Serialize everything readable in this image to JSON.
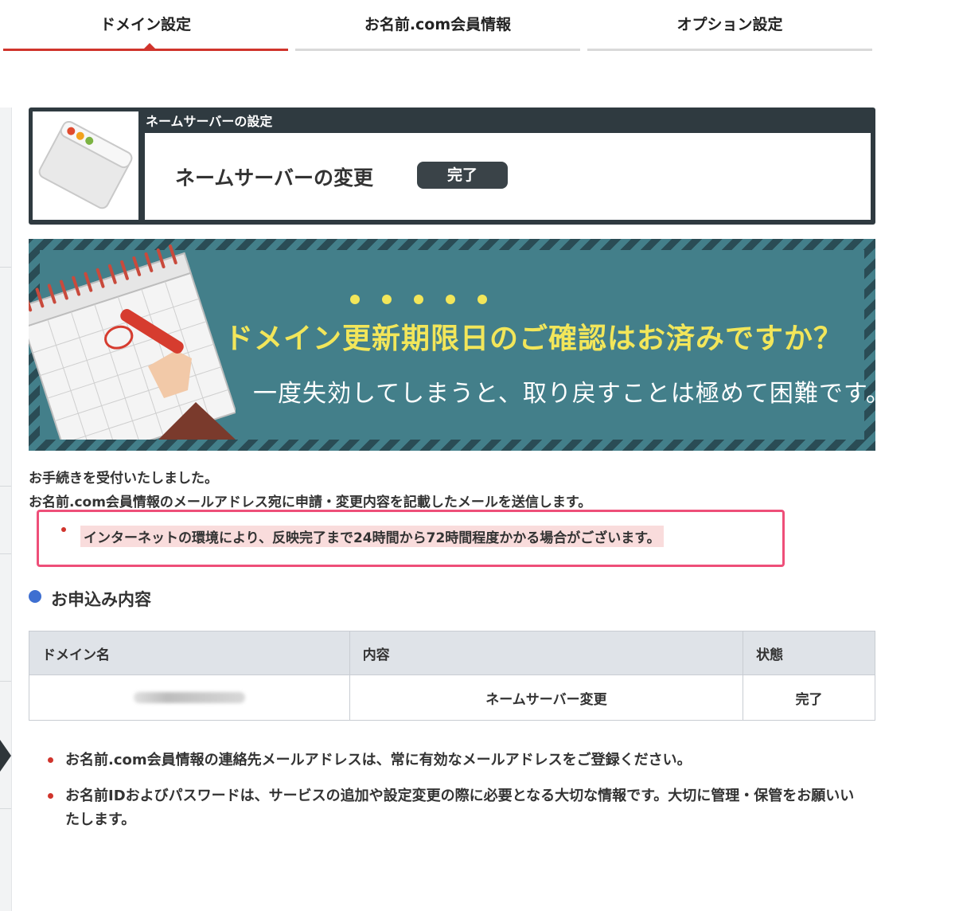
{
  "tabs": [
    {
      "label": "ドメイン設定",
      "active": true
    },
    {
      "label": "お名前.com会員情報",
      "active": false
    },
    {
      "label": "オプション設定",
      "active": false
    }
  ],
  "nameserver_panel": {
    "header": "ネームサーバーの設定",
    "title": "ネームサーバーの変更",
    "status_badge": "完了"
  },
  "banner": {
    "headline": "ドメイン更新期限日のご確認はお済みですか？",
    "subtext": "一度失効してしまうと、取り戻すことは極めて困難です。"
  },
  "messages": {
    "line1": "お手続きを受付いたしました。",
    "line2": "お名前.com会員情報のメールアドレス宛に申請・変更内容を記載したメールを送信します。"
  },
  "notice": "インターネットの環境により、反映完了まで24時間から72時間程度かかる場合がございます。",
  "application_section": {
    "title": "お申込み内容",
    "columns": [
      "ドメイン名",
      "内容",
      "状態"
    ],
    "rows": [
      {
        "content": "ネームサーバー変更",
        "status": "完了"
      }
    ]
  },
  "footer_notes": [
    "お名前.com会員情報の連絡先メールアドレスは、常に有効なメールアドレスをご登録ください。",
    "お名前IDおよびパスワードは、サービスの追加や設定変更の際に必要となる大切な情報です。大切に管理・保管をお願いいたします。"
  ],
  "colors": {
    "accent_red": "#d0342c",
    "panel_dark": "#2f3a40",
    "banner_teal": "#437f8a",
    "headline_yellow": "#f2e65a",
    "notice_border": "#ee4f79",
    "section_dot": "#3e6fd1"
  }
}
